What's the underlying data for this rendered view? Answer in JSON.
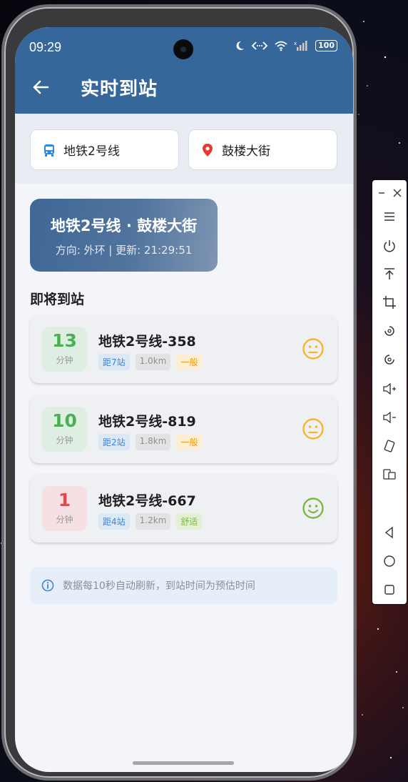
{
  "status_bar": {
    "time": "09:29",
    "battery": "100"
  },
  "header": {
    "title": "实时到站"
  },
  "filters": {
    "line": "地铁2号线",
    "station": "鼓楼大街"
  },
  "hero": {
    "title": "地铁2号线 · 鼓楼大街",
    "subtitle": "方向: 外环 | 更新: 21:29:51"
  },
  "section_title": "即将到站",
  "arrivals": [
    {
      "minutes": "13",
      "unit": "分钟",
      "vehicle": "地铁2号线-358",
      "stops": "距7站",
      "distance": "1.0km",
      "crowd": "一般",
      "crowd_level": "moderate"
    },
    {
      "minutes": "10",
      "unit": "分钟",
      "vehicle": "地铁2号线-819",
      "stops": "距2站",
      "distance": "1.8km",
      "crowd": "一般",
      "crowd_level": "moderate"
    },
    {
      "minutes": "1",
      "unit": "分钟",
      "vehicle": "地铁2号线-667",
      "stops": "距4站",
      "distance": "1.2km",
      "crowd": "舒适",
      "crowd_level": "comfortable"
    }
  ],
  "notice": "数据每10秒自动刷新，到站时间为预估时间",
  "colors": {
    "header": "#35679a",
    "green": "#4caf50",
    "red": "#e5484d",
    "orange": "#f5b727",
    "lime": "#7bb842"
  },
  "icons": {
    "back": "arrow-left-icon",
    "bus": "bus-icon",
    "location": "location-pin-icon",
    "neutral_face": "neutral-face-icon",
    "smile_face": "smile-face-icon",
    "info": "info-icon"
  }
}
